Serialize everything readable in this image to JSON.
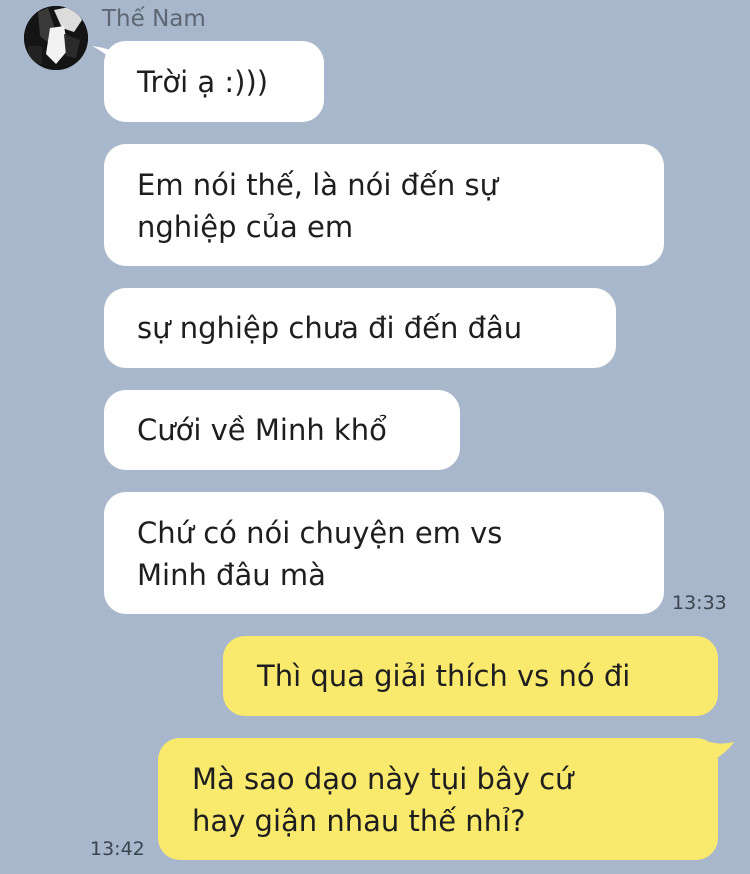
{
  "sender": {
    "name": "Thế Nam"
  },
  "messages": [
    {
      "direction": "incoming",
      "text": "Trời ạ :)))"
    },
    {
      "direction": "incoming",
      "lines": [
        "Em nói thế, là nói đến sự",
        "nghiệp của em"
      ]
    },
    {
      "direction": "incoming",
      "text": "sự nghiệp chưa đi đến đâu"
    },
    {
      "direction": "incoming",
      "text": "Cưới về Minh khổ"
    },
    {
      "direction": "incoming",
      "lines": [
        "Chứ có nói chuyện em vs",
        "Minh đâu mà"
      ],
      "time": "13:33"
    },
    {
      "direction": "outgoing",
      "text": "Thì qua giải thích vs nó đi"
    },
    {
      "direction": "outgoing",
      "lines": [
        "Mà sao dạo này tụi bây cứ",
        "hay giận nhau thế nhỉ?"
      ],
      "time": "13:42"
    }
  ],
  "colors": {
    "background": "#a8b7cb",
    "incoming_bubble": "#ffffff",
    "outgoing_bubble": "#f9ea6e",
    "sender_name": "#5d6672",
    "timestamp": "#3b4450"
  }
}
